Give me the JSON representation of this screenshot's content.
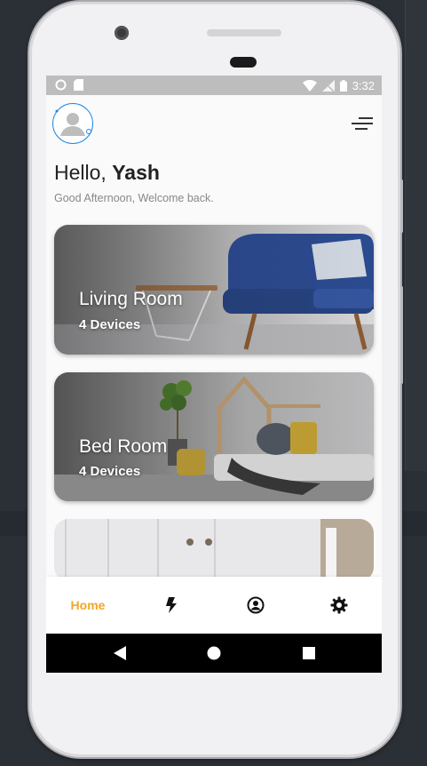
{
  "status_bar": {
    "time": "3:32"
  },
  "header": {
    "greeting_prefix": "Hello, ",
    "user_name": "Yash",
    "subtitle": "Good Afternoon, Welcome back."
  },
  "rooms": [
    {
      "name": "Living Room",
      "devices": "4 Devices"
    },
    {
      "name": "Bed Room",
      "devices": "4 Devices"
    }
  ],
  "bottom_nav": {
    "home_label": "Home",
    "icons": [
      "bolt-icon",
      "profile-icon",
      "settings-icon"
    ]
  },
  "colors": {
    "accent": "#f5a623",
    "avatar_ring": "#1e88e5",
    "sofa": "#2c4a8f"
  }
}
